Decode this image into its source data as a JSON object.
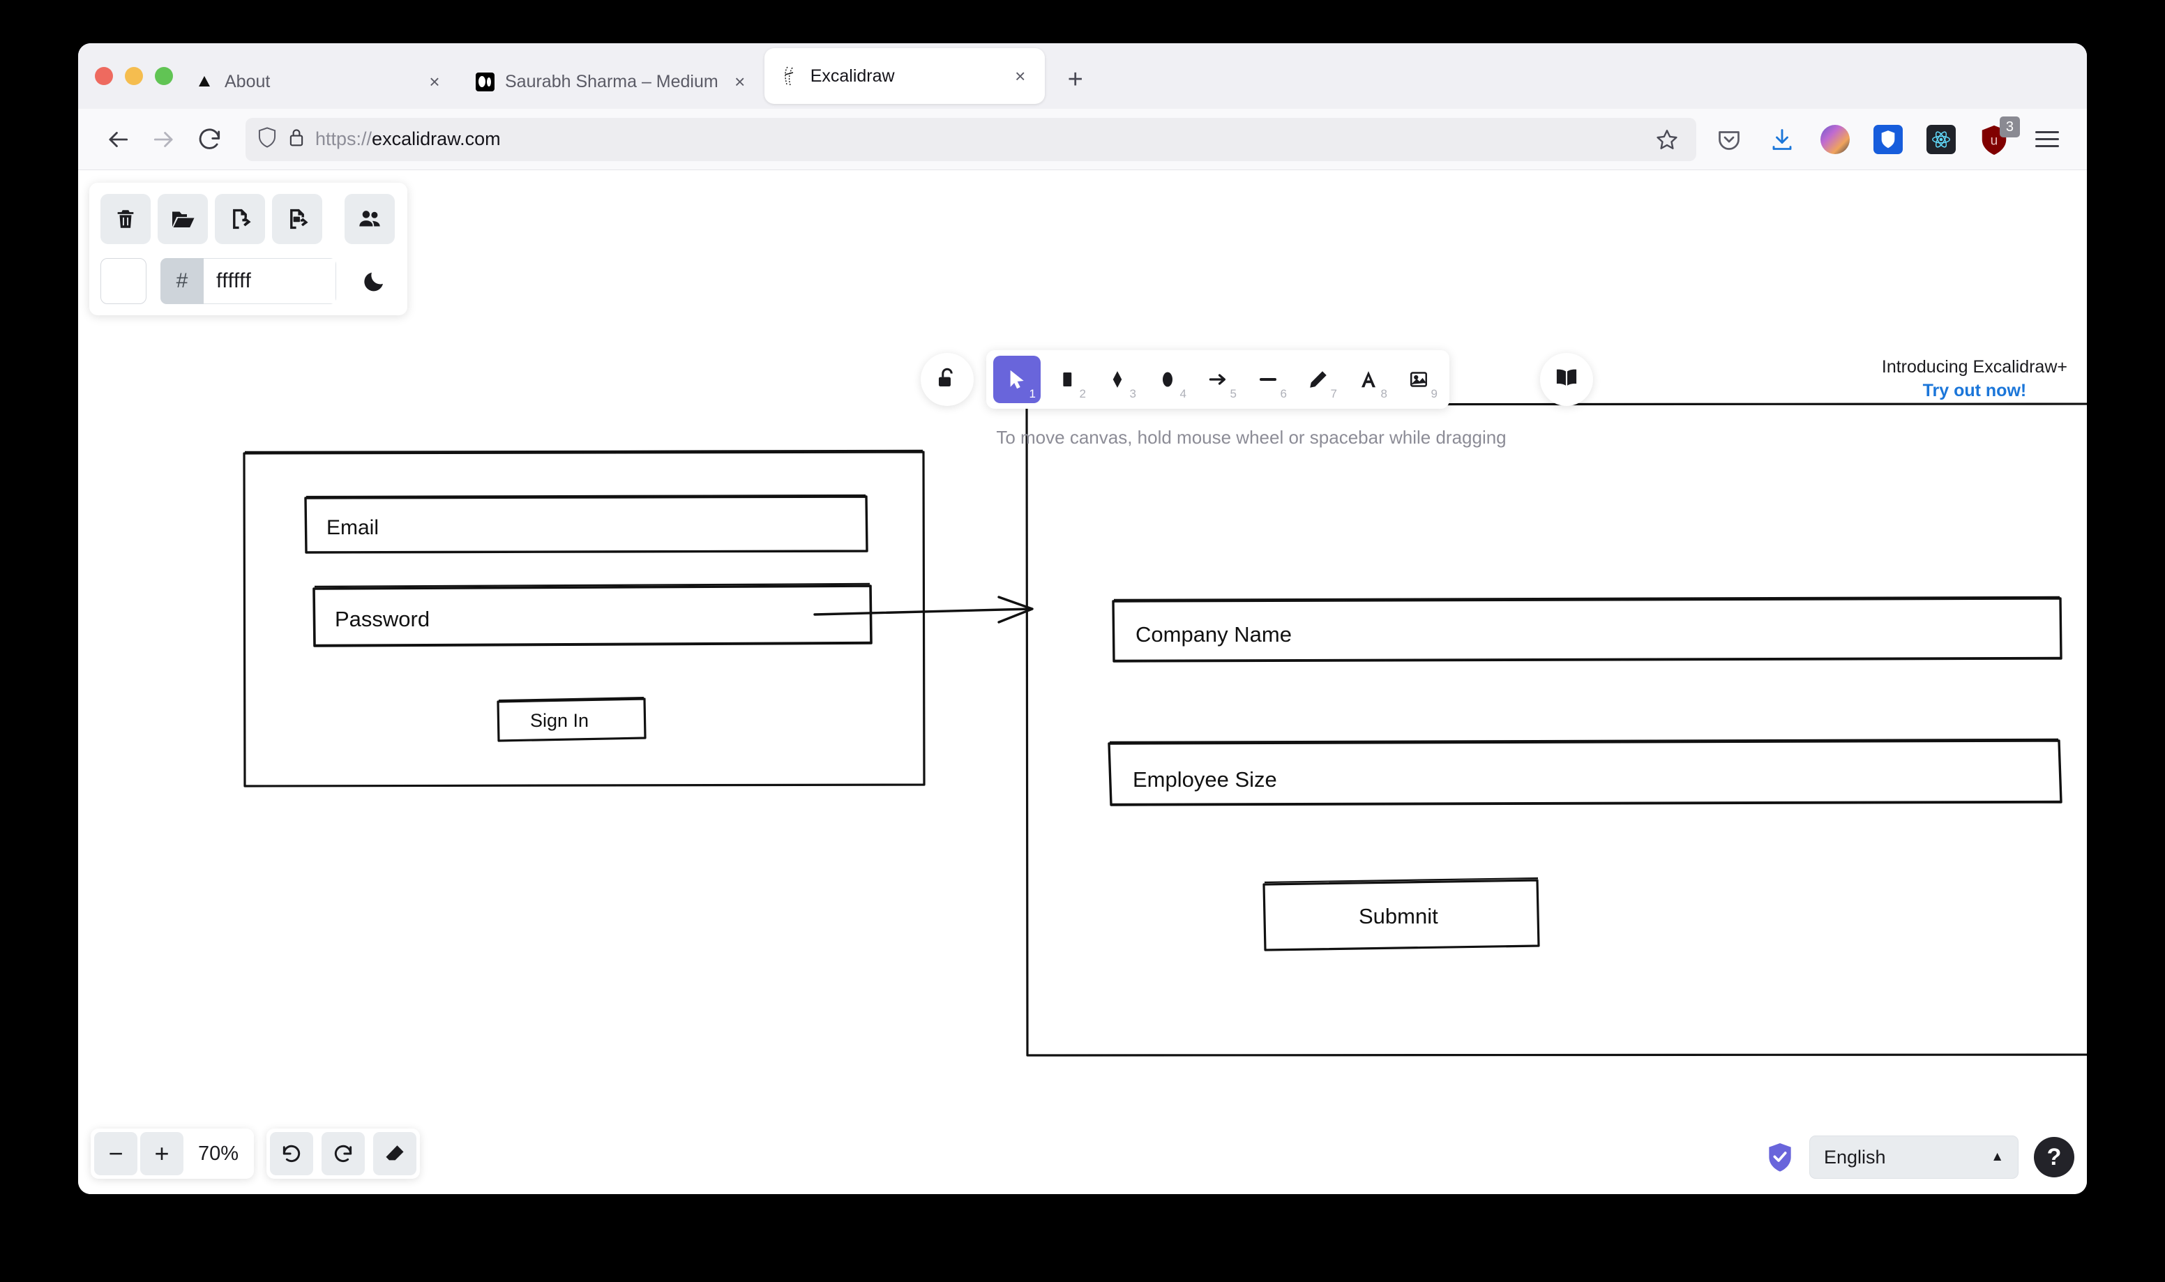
{
  "browser": {
    "tabs": [
      {
        "title": "About",
        "favicon": "firefox-about-icon",
        "active": false,
        "close_label": "×"
      },
      {
        "title": "Saurabh Sharma – Medium",
        "favicon": "medium-icon",
        "active": false,
        "close_label": "×"
      },
      {
        "title": "Excalidraw",
        "favicon": "excalidraw-icon",
        "active": true,
        "close_label": "×"
      }
    ],
    "new_tab_label": "+",
    "nav": {
      "back_icon": "back-arrow-icon",
      "forward_icon": "forward-arrow-icon",
      "reload_icon": "reload-icon"
    },
    "url": {
      "scheme": "https://",
      "host": "excalidraw.com",
      "shield_icon": "tracking-protection-shield-icon",
      "lock_icon": "lock-icon",
      "bookmark_icon": "bookmark-star-icon"
    },
    "extensions": [
      {
        "name": "pocket-icon",
        "label": ""
      },
      {
        "name": "downloads-icon",
        "label": ""
      },
      {
        "name": "account-avatar",
        "label": ""
      },
      {
        "name": "bitwarden-icon",
        "label": ""
      },
      {
        "name": "react-devtools-icon",
        "label": ""
      },
      {
        "name": "ublock-origin-icon",
        "label": "3"
      }
    ],
    "menu_icon": "hamburger-menu-icon"
  },
  "app": {
    "left_panel": {
      "buttons": [
        {
          "name": "reset-canvas-button",
          "icon": "trash-icon"
        },
        {
          "name": "open-button",
          "icon": "folder-open-icon"
        },
        {
          "name": "export-file-button",
          "icon": "export-file-icon"
        },
        {
          "name": "export-image-button",
          "icon": "export-image-icon"
        },
        {
          "name": "live-collaboration-button",
          "icon": "people-icon"
        }
      ],
      "canvas_background_label": "#",
      "canvas_background_value": "ffffff",
      "theme_toggle_icon": "moon-icon"
    },
    "lock_button": {
      "icon": "padlock-open-icon"
    },
    "toolbar": [
      {
        "name": "selection-tool",
        "icon": "cursor-icon",
        "key": "1",
        "active": true
      },
      {
        "name": "rectangle-tool",
        "icon": "rectangle-icon",
        "key": "2",
        "active": false
      },
      {
        "name": "diamond-tool",
        "icon": "diamond-icon",
        "key": "3",
        "active": false
      },
      {
        "name": "ellipse-tool",
        "icon": "ellipse-icon",
        "key": "4",
        "active": false
      },
      {
        "name": "arrow-tool",
        "icon": "arrow-icon",
        "key": "5",
        "active": false
      },
      {
        "name": "line-tool",
        "icon": "line-icon",
        "key": "6",
        "active": false
      },
      {
        "name": "draw-tool",
        "icon": "pencil-icon",
        "key": "7",
        "active": false
      },
      {
        "name": "text-tool",
        "icon": "text-a-icon",
        "key": "8",
        "active": false
      },
      {
        "name": "image-tool",
        "icon": "image-icon",
        "key": "9",
        "active": false
      }
    ],
    "library_button": {
      "icon": "book-icon"
    },
    "hint": "To move canvas, hold mouse wheel or spacebar while dragging",
    "promo": {
      "line1": "Introducing Excalidraw+",
      "line2": "Try out now!"
    },
    "footer": {
      "zoom_out_label": "−",
      "zoom_in_label": "+",
      "zoom_level": "70%",
      "undo_icon": "undo-icon",
      "redo_icon": "redo-icon",
      "eraser_icon": "eraser-icon",
      "encryption_icon": "shield-check-icon",
      "language": "English",
      "language_caret": "▲",
      "help_label": "?"
    },
    "drawing": {
      "screen_one": {
        "fields": [
          {
            "label": "Email"
          },
          {
            "label": "Password"
          }
        ],
        "button": "Sign In"
      },
      "screen_two": {
        "fields": [
          {
            "label": "Company Name"
          },
          {
            "label": "Employee Size"
          }
        ],
        "button": "Submnit"
      },
      "connector": "arrow-right"
    }
  }
}
